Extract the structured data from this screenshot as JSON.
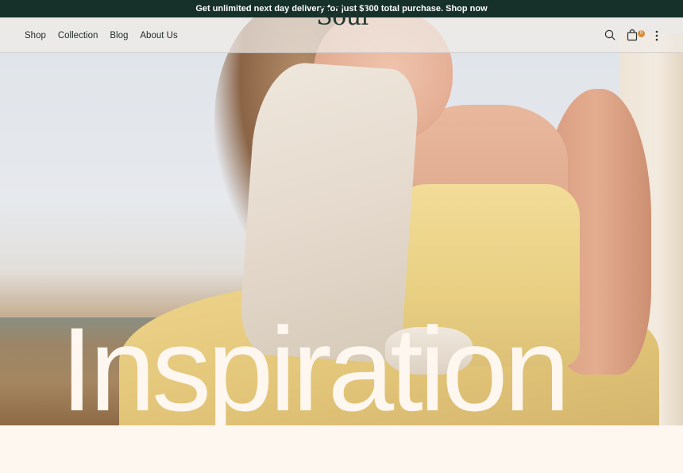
{
  "announcement": {
    "text": "Get unlimited next day delivery for just $300 total purchase. Shop now"
  },
  "header": {
    "nav": [
      {
        "label": "Shop"
      },
      {
        "label": "Collection"
      },
      {
        "label": "Blog"
      },
      {
        "label": "About Us"
      }
    ],
    "logo": "Sōul",
    "icons": {
      "search": "search-icon",
      "cart": "shopping-bag-icon",
      "menu": "more-vertical-icon"
    },
    "cart_count": "0"
  },
  "hero": {
    "headline": "Inspiration"
  },
  "colors": {
    "announcement_bg": "#16302a",
    "brand_text": "#1f3530",
    "cart_badge": "#d58b3b",
    "page_bg": "#fdf7f0"
  }
}
